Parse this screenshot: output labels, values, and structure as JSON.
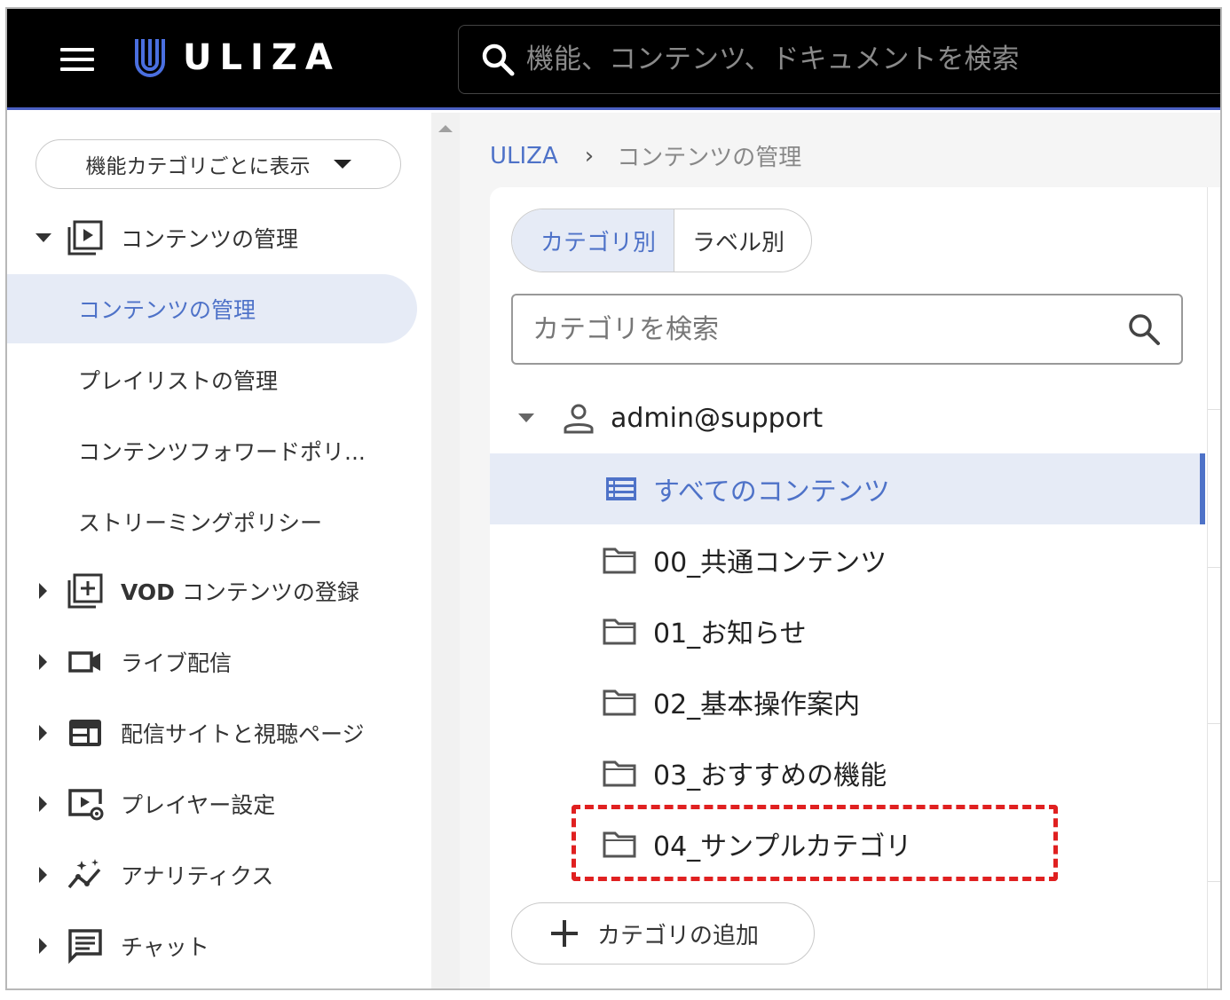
{
  "header": {
    "logo_text": "ULIZA",
    "search_placeholder": "機能、コンテンツ、ドキュメントを検索"
  },
  "sidebar": {
    "view_select_label": "機能カテゴリごとに表示",
    "groups": [
      {
        "label": "コンテンツの管理",
        "icon": "video-library-icon",
        "expanded": true
      },
      {
        "label_bold": "VOD",
        "label": " コンテンツの登録",
        "icon": "add-library-icon",
        "expanded": false
      },
      {
        "label": "ライブ配信",
        "icon": "videocam-icon",
        "expanded": false
      },
      {
        "label": "配信サイトと視聴ページ",
        "icon": "web-layout-icon",
        "expanded": false
      },
      {
        "label": "プレイヤー設定",
        "icon": "player-settings-icon",
        "expanded": false
      },
      {
        "label": "アナリティクス",
        "icon": "analytics-icon",
        "expanded": false
      },
      {
        "label": "チャット",
        "icon": "chat-icon",
        "expanded": false
      }
    ],
    "sub_items": [
      {
        "label": "コンテンツの管理",
        "active": true
      },
      {
        "label": "プレイリストの管理",
        "active": false
      },
      {
        "label": "コンテンツフォワードポリ...",
        "active": false
      },
      {
        "label": "ストリーミングポリシー",
        "active": false
      }
    ]
  },
  "main": {
    "breadcrumb": {
      "root": "ULIZA",
      "separator": "›",
      "current": "コンテンツの管理"
    },
    "toggle": {
      "category": "カテゴリ別",
      "label": "ラベル別"
    },
    "category_search_placeholder": "カテゴリを検索",
    "tree": {
      "account": "admin@support",
      "all_contents": "すべてのコンテンツ",
      "folders": [
        "00_共通コンテンツ",
        "01_お知らせ",
        "02_基本操作案内",
        "03_おすすめの機能",
        "04_サンプルカテゴリ"
      ]
    },
    "add_category_label": "カテゴリの追加"
  },
  "colors": {
    "accent": "#4e72c8",
    "selected_bg": "#e6ebf6",
    "header_bg": "#000000",
    "highlight": "#e02020"
  }
}
